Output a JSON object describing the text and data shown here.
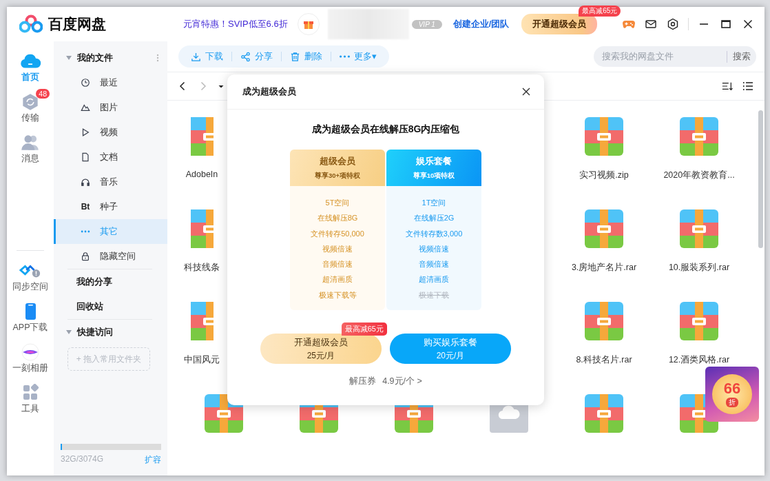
{
  "header": {
    "logo": "百度网盘",
    "promo": "元宵特惠！SVIP低至6.6折",
    "vip": "VIP 1",
    "team_link": "创建企业/团队",
    "upgrade_button": {
      "label": "开通超级会员",
      "badge": "最高减65元"
    }
  },
  "rail": {
    "top": [
      {
        "label": "首页",
        "selected": true
      },
      {
        "label": "传输",
        "badge": "48",
        "selected": false
      },
      {
        "label": "消息",
        "selected": false
      }
    ],
    "bottom": [
      {
        "label": "同步空间"
      },
      {
        "label": "APP下载"
      },
      {
        "label": "一刻相册"
      },
      {
        "label": "工具"
      }
    ]
  },
  "sidebar": {
    "sections": [
      {
        "label": "我的文件",
        "expanded": true,
        "children": [
          {
            "label": "最近",
            "selected": false
          },
          {
            "label": "图片",
            "selected": false
          },
          {
            "label": "视频",
            "selected": false
          },
          {
            "label": "文档",
            "selected": false
          },
          {
            "label": "音乐",
            "selected": false
          },
          {
            "label": "种子",
            "icon_text": "Bt",
            "selected": false
          },
          {
            "label": "其它",
            "selected": true
          },
          {
            "label": "隐藏空间",
            "selected": false
          }
        ]
      },
      {
        "label": "我的分享"
      },
      {
        "label": "回收站"
      },
      {
        "label": "快捷访问",
        "expanded": true,
        "drop_zone": "+ 拖入常用文件夹"
      }
    ],
    "storage": {
      "text": "32G/3074G",
      "level": 0.01,
      "action": "扩容"
    }
  },
  "toolbar": {
    "actions": [
      {
        "label": "下载"
      },
      {
        "label": "分享"
      },
      {
        "label": "删除"
      },
      {
        "label": "更多▾"
      }
    ],
    "search": {
      "placeholder": "搜索我的网盘文件",
      "button": "搜索"
    }
  },
  "files": {
    "rows": [
      [
        {
          "kind": "archive",
          "name": "AdobeIn"
        },
        null,
        null,
        null,
        {
          "kind": "archive",
          "name": "实习视频.zip"
        },
        {
          "kind": "archive",
          "name": "2020年教资教育..."
        }
      ],
      [
        {
          "kind": "archive",
          "name": "科技线条"
        },
        null,
        null,
        null,
        {
          "kind": "archive",
          "name": "3.房地产名片.rar"
        },
        {
          "kind": "archive",
          "name": "10.服装系列.rar"
        }
      ],
      [
        {
          "kind": "archive",
          "name": "中国风元"
        },
        null,
        null,
        null,
        {
          "kind": "archive",
          "name": "8.科技名片.rar"
        },
        {
          "kind": "archive",
          "name": "12.酒类风格.rar"
        }
      ],
      [
        {
          "kind": "archive"
        },
        {
          "kind": "archive"
        },
        {
          "kind": "archive"
        },
        {
          "kind": "cloud-folder"
        },
        {
          "kind": "archive"
        },
        {
          "kind": "archive"
        }
      ]
    ]
  },
  "promo_badge": {
    "value": "66",
    "unit": "折"
  },
  "modal": {
    "title": "成为超级会员",
    "headline": "成为超级会员在线解压8G内压缩包",
    "plans": [
      {
        "name": "超级会员",
        "subtitle": "尊享30+项特权",
        "features": [
          {
            "text": "5T空间",
            "struck": false
          },
          {
            "text": "在线解压8G",
            "struck": false
          },
          {
            "text": "文件转存50,000",
            "struck": false
          },
          {
            "text": "视频倍速",
            "struck": false
          },
          {
            "text": "音频倍速",
            "struck": false
          },
          {
            "text": "超清画质",
            "struck": false
          },
          {
            "text": "极速下载等",
            "struck": false
          }
        ]
      },
      {
        "name": "娱乐套餐",
        "subtitle": "尊享10项特权",
        "features": [
          {
            "text": "1T空间",
            "struck": false
          },
          {
            "text": "在线解压2G",
            "struck": false
          },
          {
            "text": "文件转存数3,000",
            "struck": false
          },
          {
            "text": "视频倍速",
            "struck": false
          },
          {
            "text": "音频倍速",
            "struck": false
          },
          {
            "text": "超清画质",
            "struck": false
          },
          {
            "text": "极速下载",
            "struck": true
          }
        ]
      }
    ],
    "buttons": [
      {
        "label": "开通超级会员",
        "price": "25元/月",
        "badge": "最高减65元"
      },
      {
        "label": "购买娱乐套餐",
        "price": "20元/月"
      }
    ],
    "footer": {
      "label": "解压券",
      "price": "4.9元/个 >"
    }
  }
}
